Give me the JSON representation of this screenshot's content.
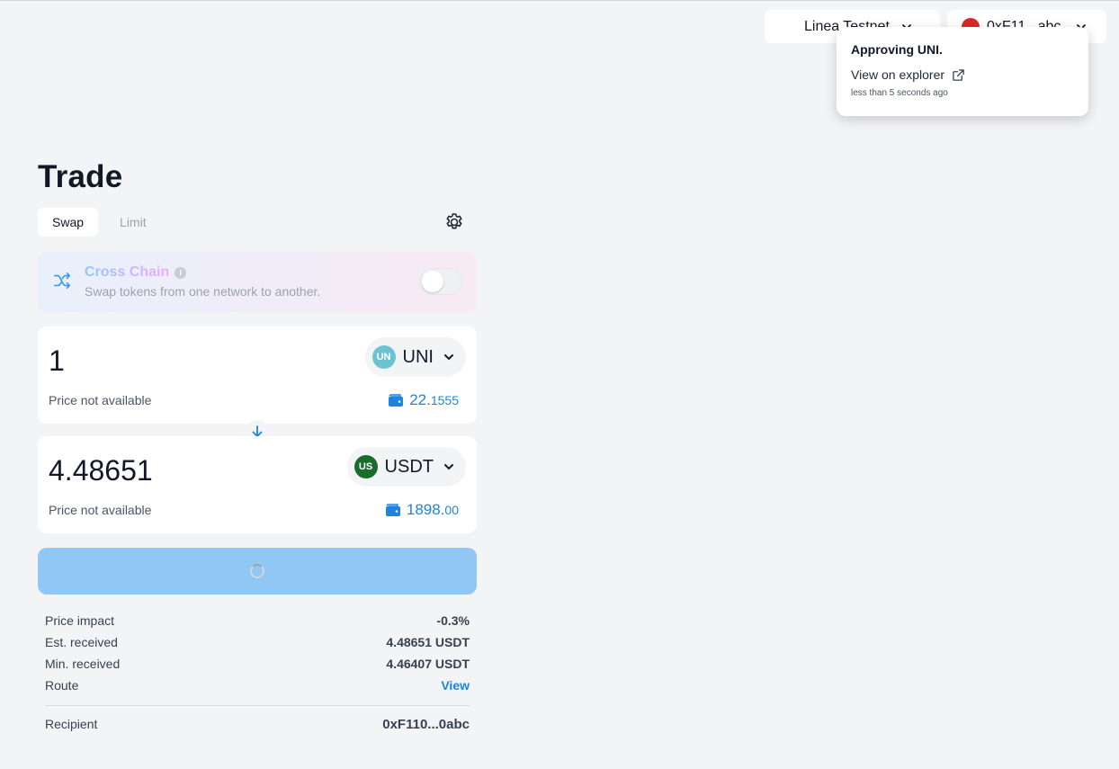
{
  "header": {
    "network": "Linea Testnet",
    "account": "0xF11...abc"
  },
  "toast": {
    "title": "Approving UNI.",
    "link_label": "View on explorer",
    "time": "less than 5 seconds ago"
  },
  "trade": {
    "title": "Trade",
    "tabs": [
      {
        "label": "Swap",
        "active": true
      },
      {
        "label": "Limit",
        "active": false
      }
    ],
    "cross_chain": {
      "title": "Cross Chain",
      "subtitle": "Swap tokens from one network to another.",
      "enabled": false
    },
    "from": {
      "amount": "1",
      "token": "UNI",
      "token_logo_text": "UN",
      "token_logo_color": "#6bc2d1",
      "price": "Price not available",
      "balance_main": "22.",
      "balance_dec": "1555"
    },
    "to": {
      "amount": "4.48651",
      "token": "USDT",
      "token_logo_text": "US",
      "token_logo_color": "#1a6b2c",
      "price": "Price not available",
      "balance_main": "1898.",
      "balance_dec": "00"
    },
    "details": [
      {
        "label": "Price impact",
        "value": "-0.3%"
      },
      {
        "label": "Est. received",
        "value": "4.48651 USDT"
      },
      {
        "label": "Min. received",
        "value": "4.46407 USDT"
      },
      {
        "label": "Route",
        "value": "View"
      }
    ],
    "recipient": {
      "label": "Recipient",
      "value": "0xF110...0abc"
    }
  },
  "colors": {
    "accent": "#1d84e0",
    "button_disabled": "#91c7f5"
  },
  "icons": [
    "chevron-down-icon",
    "external-link-icon",
    "gear-icon",
    "shuffle-icon",
    "info-icon",
    "wallet-icon",
    "arrow-down-icon",
    "spinner-icon"
  ]
}
